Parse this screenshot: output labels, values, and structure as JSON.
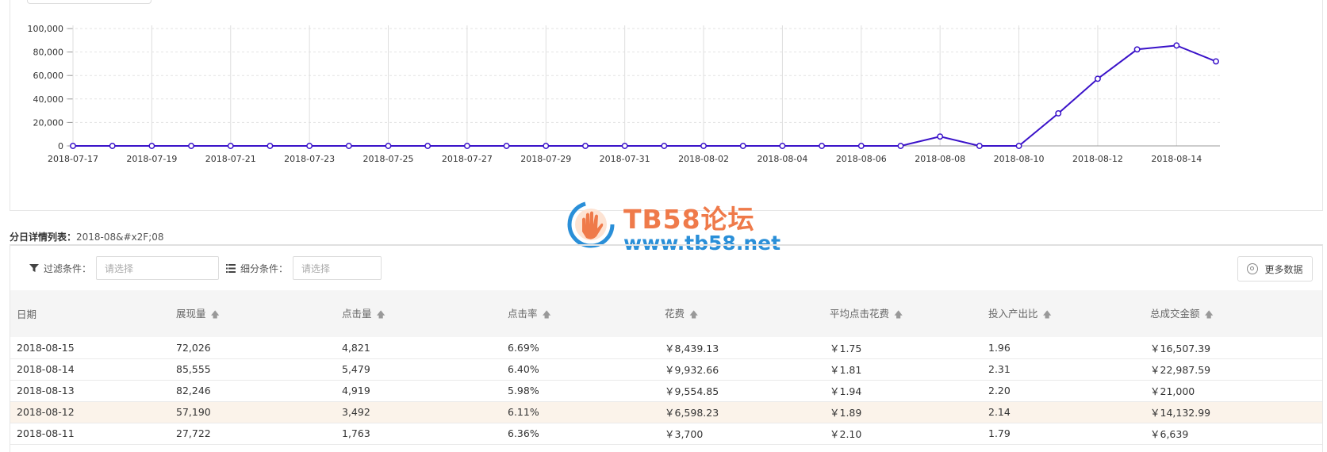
{
  "colors": {
    "line": "#3a12c9",
    "grid": "#e6e6e6",
    "watermark_title": "#ef7a4a",
    "watermark_url": "#2a8fd8",
    "highlight_row": "#fbf3ea"
  },
  "chart_data": {
    "type": "line",
    "x": [
      "2018-07-17",
      "2018-07-18",
      "2018-07-19",
      "2018-07-20",
      "2018-07-21",
      "2018-07-22",
      "2018-07-23",
      "2018-07-24",
      "2018-07-25",
      "2018-07-26",
      "2018-07-27",
      "2018-07-28",
      "2018-07-29",
      "2018-07-30",
      "2018-07-31",
      "2018-08-01",
      "2018-08-02",
      "2018-08-03",
      "2018-08-04",
      "2018-08-05",
      "2018-08-06",
      "2018-08-07",
      "2018-08-08",
      "2018-08-09",
      "2018-08-10",
      "2018-08-11",
      "2018-08-12",
      "2018-08-13",
      "2018-08-14",
      "2018-08-15"
    ],
    "x_tick_labels": [
      "2018-07-17",
      "2018-07-19",
      "2018-07-21",
      "2018-07-23",
      "2018-07-25",
      "2018-07-27",
      "2018-07-29",
      "2018-07-31",
      "2018-08-02",
      "2018-08-04",
      "2018-08-06",
      "2018-08-08",
      "2018-08-10",
      "2018-08-12",
      "2018-08-14"
    ],
    "series": [
      {
        "values": [
          0,
          0,
          0,
          0,
          0,
          0,
          0,
          0,
          0,
          0,
          0,
          0,
          0,
          0,
          0,
          0,
          0,
          0,
          0,
          0,
          0,
          0,
          8000,
          0,
          0,
          27722,
          57190,
          82246,
          85555,
          72026
        ]
      }
    ],
    "ylim": [
      0,
      100000
    ],
    "y_ticks": [
      "0",
      "20,000",
      "40,000",
      "60,000",
      "80,000",
      "100,000"
    ],
    "grid": "horizontal dashed, vertical at labeled dates"
  },
  "watermark": {
    "title": "TB58论坛",
    "url": "www.tb58.net"
  },
  "list": {
    "title": "分日详情列表：",
    "date": "2018-08&#x2F;08"
  },
  "filters": {
    "filter_label": "过滤条件：",
    "filter_placeholder": "请选择",
    "filter_icon": "funnel-icon",
    "segment_label": "细分条件：",
    "segment_placeholder": "请选择",
    "segment_icon": "list-icon",
    "more_label": "更多数据",
    "more_icon": "gear-icon"
  },
  "table": {
    "headers": [
      "日期",
      "展现量",
      "点击量",
      "点击率",
      "花费",
      "平均点击花费",
      "投入产出比",
      "总成交金额"
    ],
    "sort_icon": "sort-arrow-icon",
    "rows": [
      [
        "2018-08-15",
        "72,026",
        "4,821",
        "6.69%",
        "￥8,439.13",
        "￥1.75",
        "1.96",
        "￥16,507.39"
      ],
      [
        "2018-08-14",
        "85,555",
        "5,479",
        "6.40%",
        "￥9,932.66",
        "￥1.81",
        "2.31",
        "￥22,987.59"
      ],
      [
        "2018-08-13",
        "82,246",
        "4,919",
        "5.98%",
        "￥9,554.85",
        "￥1.94",
        "2.20",
        "￥21,000"
      ],
      [
        "2018-08-12",
        "57,190",
        "3,492",
        "6.11%",
        "￥6,598.23",
        "￥1.89",
        "2.14",
        "￥14,132.99"
      ],
      [
        "2018-08-11",
        "27,722",
        "1,763",
        "6.36%",
        "￥3,700",
        "￥2.10",
        "1.79",
        "￥6,639"
      ]
    ]
  }
}
